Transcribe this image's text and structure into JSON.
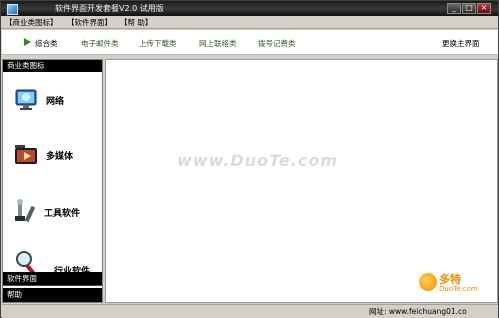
{
  "window": {
    "title": "软件界面开发套餐V2.0 试用版"
  },
  "menubar": {
    "items": [
      "【商业类图标】",
      "【软件界面】",
      "【帮 助】"
    ]
  },
  "toolbar": {
    "tabs": [
      {
        "label": "综合类",
        "active": true
      },
      {
        "label": "电子邮件类",
        "active": false
      },
      {
        "label": "上传下载类",
        "active": false
      },
      {
        "label": "网上联络类",
        "active": false
      },
      {
        "label": "拨号记费类",
        "active": false
      }
    ],
    "right_link": "更换主界面"
  },
  "sidebar": {
    "section_title": "商业类图标",
    "items": [
      {
        "label": "网络",
        "icon": "network-monitor-icon"
      },
      {
        "label": "多媒体",
        "icon": "multimedia-video-icon"
      },
      {
        "label": "工具软件",
        "icon": "tools-icon"
      },
      {
        "label": "行业软件",
        "icon": "industry-magnifier-icon"
      }
    ],
    "footer_items": [
      "软件界面",
      "帮助"
    ]
  },
  "content": {
    "watermark": "www.DuoTe.com"
  },
  "statusbar": {
    "site_text": "网址: www.feichuang01.co"
  },
  "brand": {
    "name": "多特",
    "sub": "DuoTe.com"
  },
  "colors": {
    "titlebar": "#222222",
    "sidebar_head": "#000000",
    "toolbar_arrow": "#2f8a1f",
    "brand": "#f08a00"
  }
}
